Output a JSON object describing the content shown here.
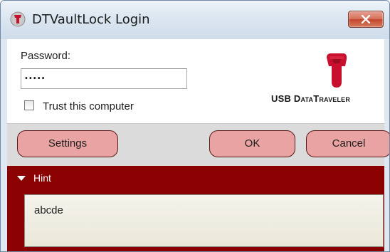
{
  "window": {
    "title": "DTVaultLock Login"
  },
  "login": {
    "password_label": "Password:",
    "password_value": "•••••",
    "trust_checked": false,
    "trust_label": "Trust this computer"
  },
  "brand": {
    "text": "USB DataTraveler",
    "accent_color": "#c8102e"
  },
  "buttons": {
    "settings": "Settings",
    "ok": "OK",
    "cancel": "Cancel"
  },
  "hint": {
    "title": "Hint",
    "expanded": true,
    "text": "abcde"
  },
  "icons": {
    "app": "kingston-logo-icon",
    "close": "close-icon",
    "hint_toggle": "triangle-down-icon"
  },
  "colors": {
    "hint_panel": "#8b0000",
    "button_fill": "#e9a3a3",
    "close_button": "#c4452d"
  }
}
